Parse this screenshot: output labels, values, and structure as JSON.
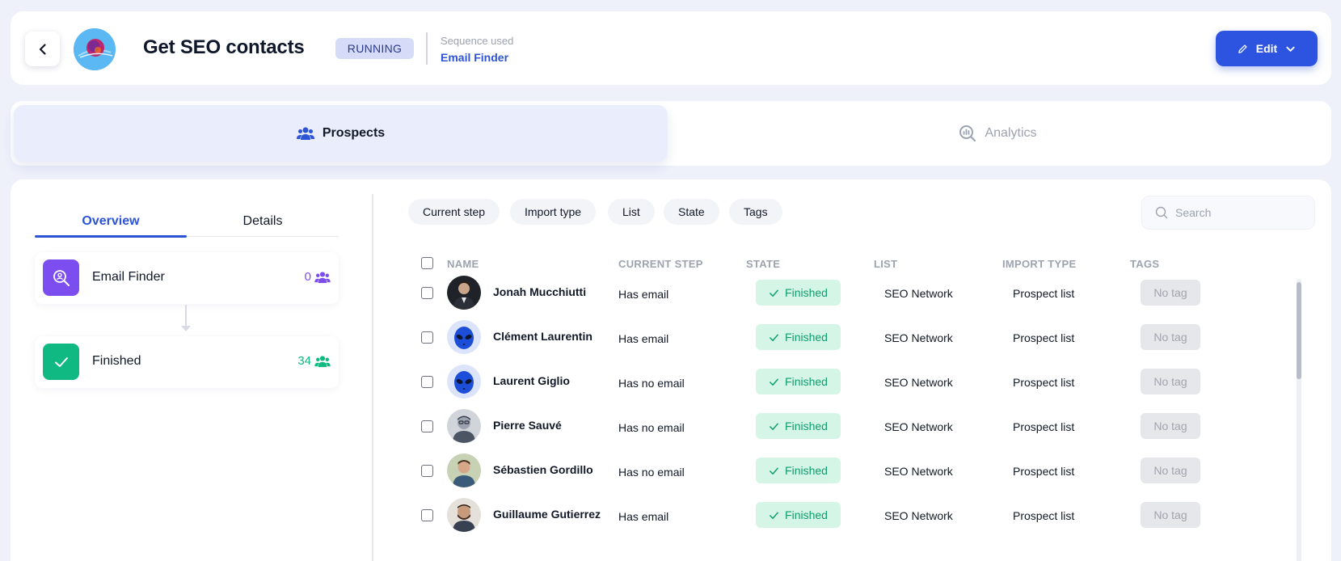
{
  "header": {
    "title": "Get SEO contacts",
    "status": "RUNNING",
    "sequence_label": "Sequence used",
    "sequence_name": "Email Finder",
    "edit_label": "Edit"
  },
  "main_tabs": [
    {
      "label": "Prospects",
      "icon": "users-icon",
      "active": true
    },
    {
      "label": "Analytics",
      "icon": "analytics-search-icon",
      "active": false
    }
  ],
  "sub_tabs": [
    {
      "label": "Overview",
      "active": true
    },
    {
      "label": "Details",
      "active": false
    }
  ],
  "steps": [
    {
      "name": "Email Finder",
      "count": "0",
      "color": "#7c4ef0",
      "icon": "search-user-icon"
    },
    {
      "name": "Finished",
      "count": "34",
      "color": "#10b981",
      "icon": "check-icon"
    }
  ],
  "filters": [
    "Current step",
    "Import type",
    "List",
    "State",
    "Tags"
  ],
  "search": {
    "placeholder": "Search"
  },
  "table": {
    "columns": [
      "NAME",
      "CURRENT STEP",
      "STATE",
      "LIST",
      "IMPORT TYPE",
      "TAGS"
    ],
    "rows": [
      {
        "name": "Jonah Mucchiutti",
        "current_step": "Has email",
        "state": "Finished",
        "list": "SEO Network",
        "import_type": "Prospect list",
        "tags": "No tag"
      },
      {
        "name": "Clément Laurentin",
        "current_step": "Has email",
        "state": "Finished",
        "list": "SEO Network",
        "import_type": "Prospect list",
        "tags": "No tag"
      },
      {
        "name": "Laurent Giglio",
        "current_step": "Has no email",
        "state": "Finished",
        "list": "SEO Network",
        "import_type": "Prospect list",
        "tags": "No tag"
      },
      {
        "name": "Pierre Sauvé",
        "current_step": "Has no email",
        "state": "Finished",
        "list": "SEO Network",
        "import_type": "Prospect list",
        "tags": "No tag"
      },
      {
        "name": "Sébastien Gordillo",
        "current_step": "Has no email",
        "state": "Finished",
        "list": "SEO Network",
        "import_type": "Prospect list",
        "tags": "No tag"
      },
      {
        "name": "Guillaume Gutierrez",
        "current_step": "Has email",
        "state": "Finished",
        "list": "SEO Network",
        "import_type": "Prospect list",
        "tags": "No tag"
      }
    ]
  },
  "colors": {
    "primary": "#2d54e0",
    "success": "#10b981",
    "purple": "#7c4ef0",
    "background": "#eef0fa"
  }
}
